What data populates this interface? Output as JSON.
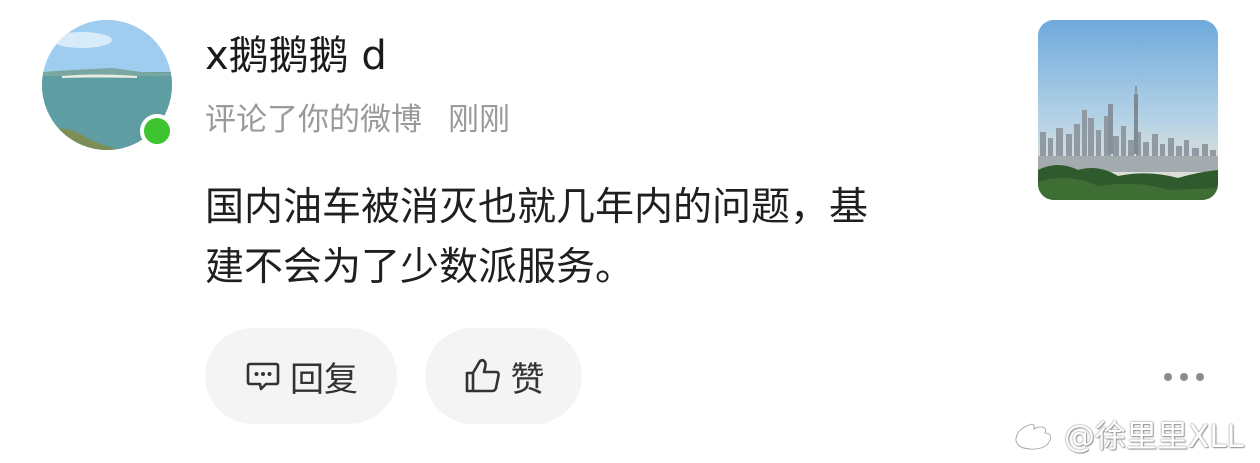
{
  "user": {
    "name": "x鹅鹅鹅 d",
    "action": "评论了你的微博",
    "time": "刚刚",
    "online": true
  },
  "comment": {
    "lines": [
      "国内油车被消灭也就几年内的问题，基",
      "建不会为了少数派服务。"
    ]
  },
  "actions": {
    "reply_label": "回复",
    "like_label": "赞"
  },
  "icons": {
    "reply": "comment-bubble-icon",
    "like": "thumbs-up-icon",
    "more": "more-dots-icon",
    "watermark": "weibo-logo-icon"
  },
  "watermark": {
    "text": "@徐里里XLL"
  },
  "colors": {
    "online": "#3fc431",
    "muted_text": "#9a9a9a",
    "pill_bg": "#f4f4f4"
  }
}
